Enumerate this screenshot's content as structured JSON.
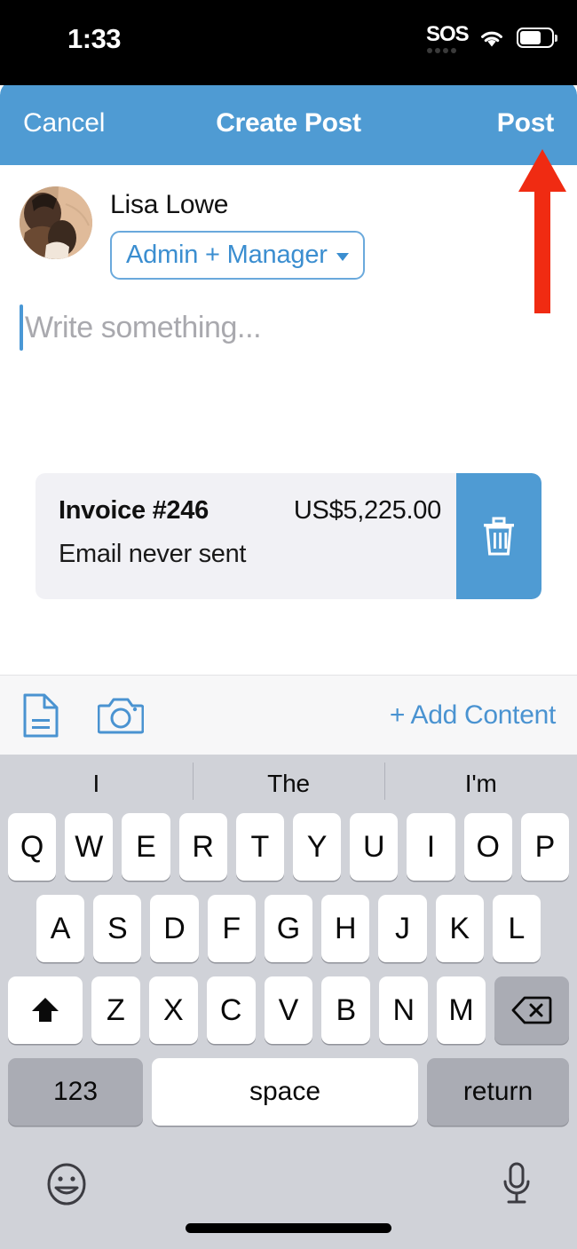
{
  "status_bar": {
    "time": "1:33",
    "sos_label": "SOS",
    "wifi_icon": "wifi-icon",
    "battery_icon": "battery-icon",
    "battery_level_pct": 62
  },
  "nav": {
    "cancel_label": "Cancel",
    "title": "Create Post",
    "post_label": "Post",
    "bg_color": "#4f9bd3"
  },
  "compose": {
    "author_name": "Lisa Lowe",
    "role_label": "Admin + Manager",
    "role_chevron_icon": "chevron-down-icon",
    "placeholder": "Write something...",
    "avatar_icon": "avatar"
  },
  "attachment": {
    "title": "Invoice #246",
    "amount": "US$5,225.00",
    "status": "Email never sent",
    "delete_icon": "trash-icon",
    "delete_bg_color": "#4f9bd3",
    "card_bg_color": "#f1f1f5"
  },
  "toolbar": {
    "document_icon": "document-icon",
    "camera_icon": "camera-icon",
    "add_content_label": "+ Add Content",
    "accent_color": "#4a93d1"
  },
  "keyboard": {
    "predictions": [
      "I",
      "The",
      "I'm"
    ],
    "row1": [
      "Q",
      "W",
      "E",
      "R",
      "T",
      "Y",
      "U",
      "I",
      "O",
      "P"
    ],
    "row2": [
      "A",
      "S",
      "D",
      "F",
      "G",
      "H",
      "J",
      "K",
      "L"
    ],
    "row3": [
      "Z",
      "X",
      "C",
      "V",
      "B",
      "N",
      "M"
    ],
    "shift_icon": "shift-icon",
    "backspace_icon": "backspace-icon",
    "numbers_label": "123",
    "space_label": "space",
    "return_label": "return",
    "emoji_icon": "emoji-icon",
    "mic_icon": "microphone-icon",
    "bg_color": "#d0d2d8"
  },
  "annotation": {
    "arrow_icon": "up-arrow-annotation",
    "color": "#f02b12",
    "points_at": "Post"
  }
}
